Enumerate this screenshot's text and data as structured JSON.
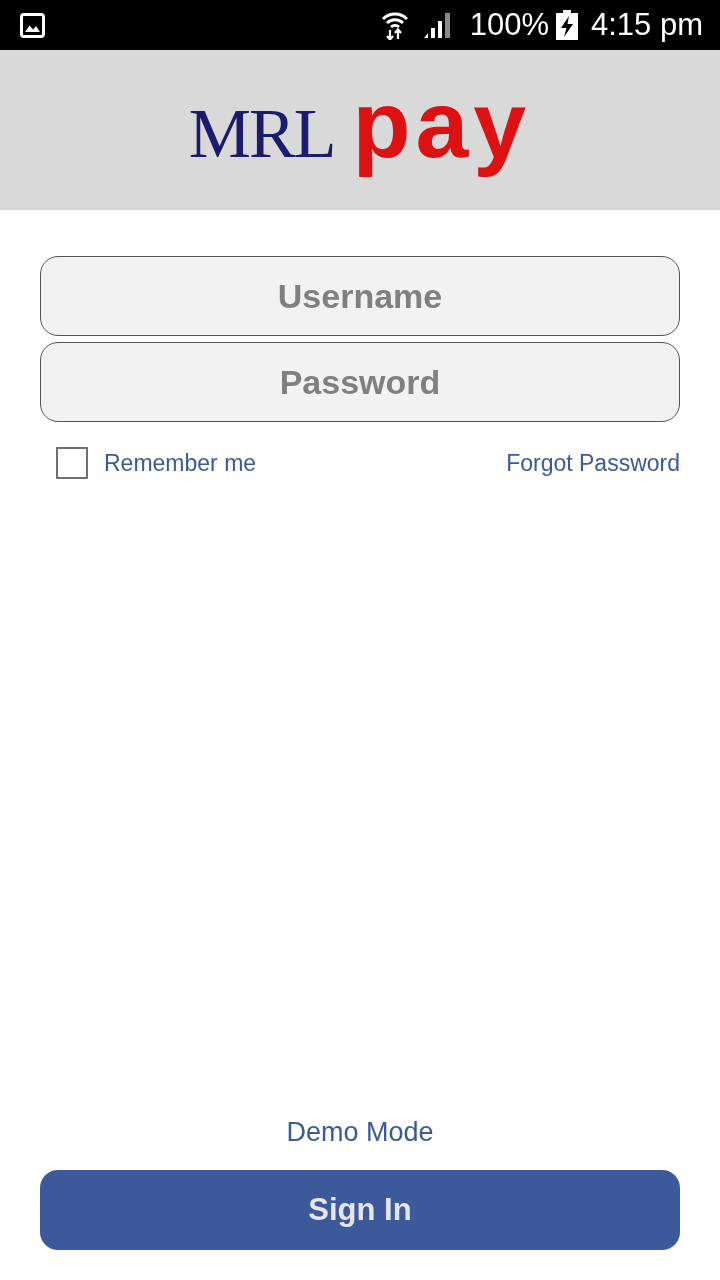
{
  "status_bar": {
    "battery": "100%",
    "charging": true,
    "time": "4:15 pm"
  },
  "header": {
    "logo": {
      "prefix": "MRL",
      "suffix": "pay"
    }
  },
  "login_form": {
    "fields": [
      {
        "placeholder": "Username"
      },
      {
        "placeholder": "Password"
      }
    ],
    "remember_me": {
      "label": "Remember me",
      "checked": false
    },
    "forgot_password_link": "Forgot Password"
  },
  "demo_mode_link": "Demo Mode",
  "sign_in_button": "Sign In"
}
